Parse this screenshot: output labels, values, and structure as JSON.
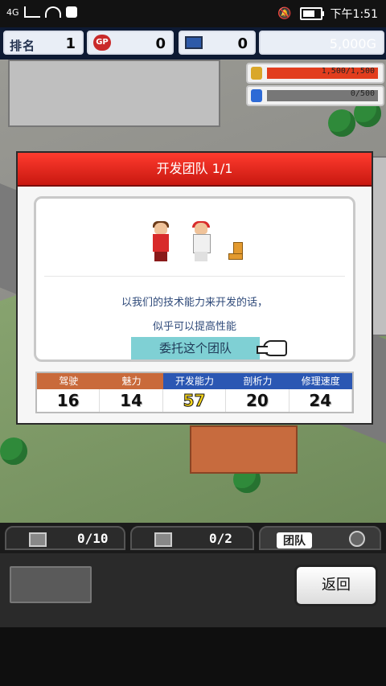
{
  "status_bar": {
    "network": "4G",
    "time": "下午1:51"
  },
  "hud": {
    "rank_label": "排名",
    "rank_value": "1",
    "gp_label": "GP",
    "gp_value": "0",
    "pc_value": "0",
    "money": "5,000G"
  },
  "resources": [
    {
      "icon": "coin-icon",
      "text": "1,500/1,500",
      "fill": 1.0
    },
    {
      "icon": "potion-icon",
      "text": "0/500",
      "fill": 0.0
    }
  ],
  "dialog": {
    "title": "开发团队 1/1",
    "message_line1": "以我们的技术能力来开发的话，",
    "message_line2": "似乎可以提高性能",
    "cta": "委托这个团队"
  },
  "stats": {
    "headers": [
      "驾驶",
      "魅力",
      "开发能力",
      "剖析力",
      "修理速度"
    ],
    "values": [
      "16",
      "14",
      "57",
      "20",
      "24"
    ],
    "header_colors": [
      "#c96a3b",
      "#c96a3b",
      "#2b57b3",
      "#2b57b3",
      "#2b57b3"
    ]
  },
  "tabs": [
    {
      "label": "0/10",
      "icon": "crate-icon"
    },
    {
      "label": "0/2",
      "icon": "car-icon"
    },
    {
      "label": "团队",
      "icon": "person-icon"
    }
  ],
  "bottom": {
    "back_label": "返回"
  }
}
